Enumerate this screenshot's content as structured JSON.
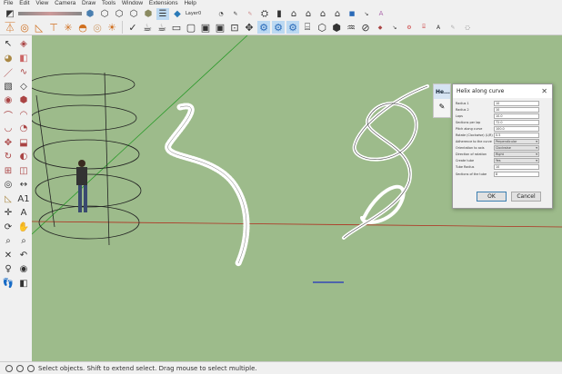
{
  "menu": [
    "File",
    "Edit",
    "View",
    "Camera",
    "Draw",
    "Tools",
    "Window",
    "Extensions",
    "Help"
  ],
  "toolbar": {
    "scene_tab": "Layer0"
  },
  "status": {
    "text": "Select objects. Shift to extend select. Drag mouse to select multiple."
  },
  "mini_panel": {
    "title": "He..."
  },
  "dialog": {
    "title": "Helix along curve",
    "close": "✕",
    "fields": [
      {
        "label": "Radius 1",
        "value": "10"
      },
      {
        "label": "Radius 2",
        "value": "10"
      },
      {
        "label": "Laps",
        "value": "10.0"
      },
      {
        "label": "Sections per lap",
        "value": "72.0"
      },
      {
        "label": "Pitch along curve",
        "value": "100.0"
      },
      {
        "label": "Rotate (Clockwise) (L/R)",
        "value": "0.5"
      },
      {
        "label": "Adherence to the curve",
        "value": "Perpendicular"
      },
      {
        "label": "Orientation to axis",
        "value": "Clockwise"
      },
      {
        "label": "Direction of rotation",
        "value": "Right"
      },
      {
        "label": "Create tube",
        "value": "Yes"
      },
      {
        "label": "Tube Radius",
        "value": "10"
      },
      {
        "label": "Sections of the tube",
        "value": "8"
      }
    ],
    "ok": "OK",
    "cancel": "Cancel"
  },
  "colors": {
    "viewport": "#9dbb8b",
    "axis_red": "#b03020",
    "axis_green": "#2a9a2a",
    "axis_blue": "#2030c0"
  }
}
